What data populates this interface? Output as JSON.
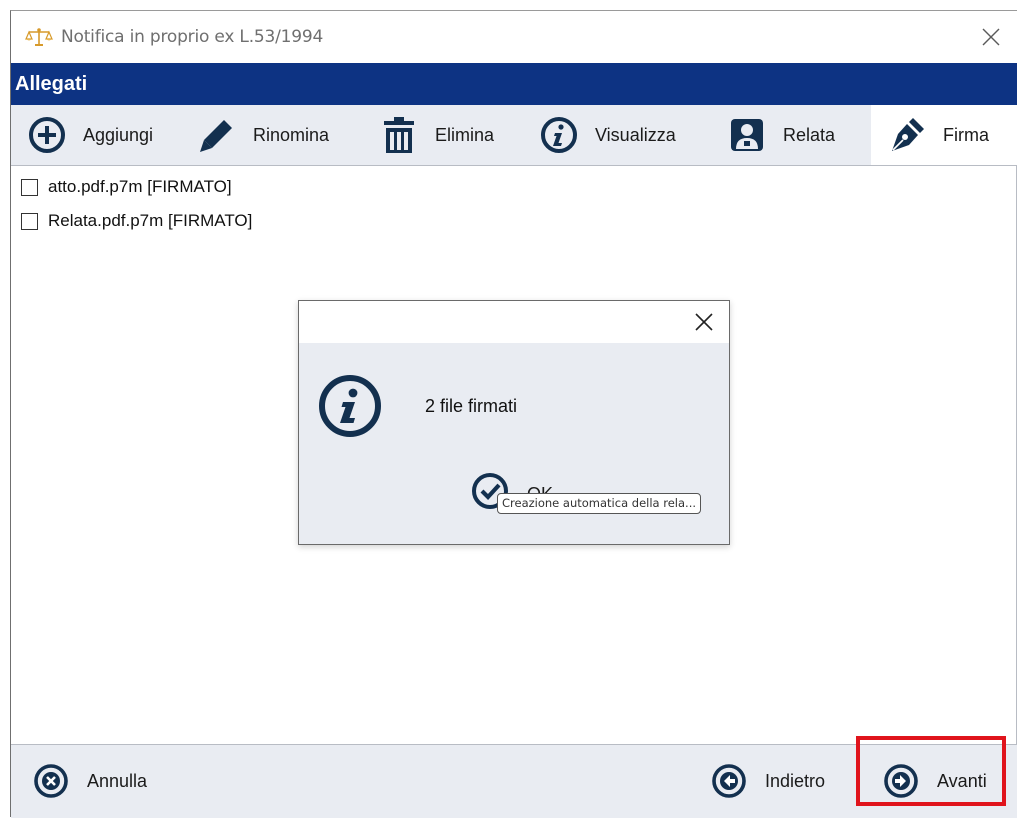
{
  "window": {
    "title": "Notifica in proprio ex L.53/1994"
  },
  "section": {
    "title": "Allegati"
  },
  "toolbar": {
    "items": [
      {
        "label": "Aggiungi",
        "icon": "plus-circle-icon"
      },
      {
        "label": "Rinomina",
        "icon": "pencil-icon"
      },
      {
        "label": "Elimina",
        "icon": "trash-icon"
      },
      {
        "label": "Visualizza",
        "icon": "info-circle-icon"
      },
      {
        "label": "Relata",
        "icon": "person-badge-icon"
      },
      {
        "label": "Firma",
        "icon": "pen-nib-icon",
        "active": true
      }
    ]
  },
  "files": [
    {
      "name": "atto.pdf.p7m [FIRMATO]",
      "checked": false
    },
    {
      "name": "Relata.pdf.p7m [FIRMATO]",
      "checked": false
    }
  ],
  "dialog": {
    "message": "2 file firmati",
    "ok_label": "OK",
    "icon": "info-circle-icon",
    "tooltip": "Creazione automatica della rela..."
  },
  "footer": {
    "cancel_label": "Annulla",
    "back_label": "Indietro",
    "next_label": "Avanti"
  },
  "colors": {
    "header_bg": "#0d3383",
    "icon_color": "#13304f",
    "toolbar_bg": "#e9ecf2",
    "highlight": "#e0141c"
  }
}
